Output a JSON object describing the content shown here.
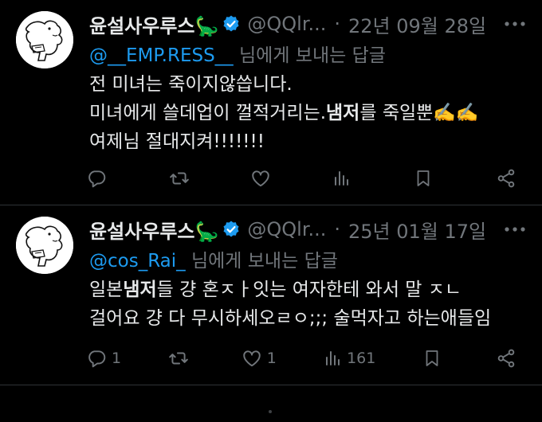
{
  "colors": {
    "background": "#000000",
    "text": "#e7e9ea",
    "secondary": "#71767b",
    "accent": "#1d9bf0",
    "divider": "#2f3336"
  },
  "tweets": [
    {
      "display_name": "윤설사우루스🦕",
      "handle": "@QQlr...",
      "separator": "·",
      "date": "22년 09월 28일",
      "reply_mention": "@__EMP.RESS__",
      "reply_suffix": " 님에게 보내는 답글",
      "body_lines": [
        [
          "전 미녀는 죽이지않씁니다."
        ],
        [
          "미녀에게 쓸데업이 껄적거리는.",
          "냄저",
          "를 죽일뿐✍️✍️"
        ],
        [
          "여제님 절대지켜!!!!!!!"
        ]
      ],
      "actions": {
        "reply": {
          "icon": "reply-icon",
          "count": ""
        },
        "retweet": {
          "icon": "retweet-icon",
          "count": ""
        },
        "like": {
          "icon": "like-icon",
          "count": ""
        },
        "views": {
          "icon": "views-icon",
          "count": ""
        },
        "bookmark": {
          "icon": "bookmark-icon"
        },
        "share": {
          "icon": "share-icon"
        }
      }
    },
    {
      "display_name": "윤설사우루스🦕",
      "handle": "@QQlr...",
      "separator": "·",
      "date": "25년 01월 17일",
      "reply_mention": "@cos_Rai_",
      "reply_suffix": " 님에게 보내는 답글",
      "body_lines": [
        [
          "일본",
          "냄저",
          "들 걍 혼ㅈㅏ잇는 여자한테 와서 말 ㅈㄴ"
        ],
        [
          "걸어요 걍 다 무시하세오ㄹㅇ;;; 술먹자고 하는애들임"
        ]
      ],
      "actions": {
        "reply": {
          "icon": "reply-icon",
          "count": "1"
        },
        "retweet": {
          "icon": "retweet-icon",
          "count": ""
        },
        "like": {
          "icon": "like-icon",
          "count": "1"
        },
        "views": {
          "icon": "views-icon",
          "count": "161"
        },
        "bookmark": {
          "icon": "bookmark-icon"
        },
        "share": {
          "icon": "share-icon"
        }
      }
    }
  ]
}
